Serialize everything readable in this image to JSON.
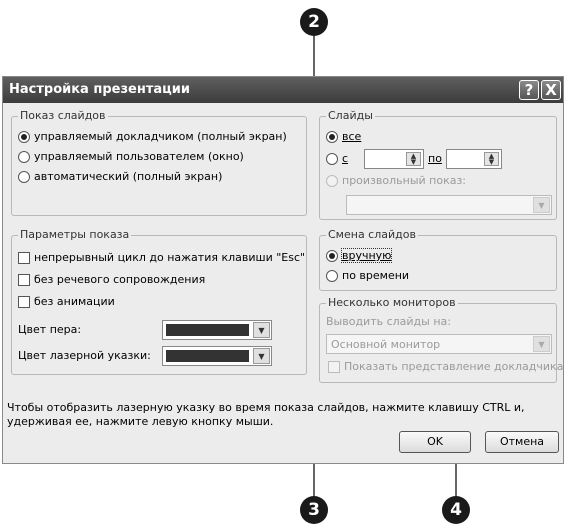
{
  "dialog": {
    "title": "Настройка презентации",
    "help_glyph": "?",
    "close_glyph": "X"
  },
  "show_slides": {
    "title": "Показ слайдов",
    "options": [
      {
        "label": "управляемый докладчиком (полный экран)",
        "selected": true
      },
      {
        "label": "управляемый пользователем (окно)",
        "selected": false
      },
      {
        "label": "автоматический (полный экран)",
        "selected": false
      }
    ]
  },
  "slides": {
    "title": "Слайды",
    "all_label": "все",
    "from_label": "с",
    "to_label": "по",
    "from_value": "",
    "to_value": "",
    "custom_label": "произвольный показ:",
    "custom_value": ""
  },
  "show_options": {
    "title": "Параметры показа",
    "loop_label": "непрерывный цикл до нажатия клавиши \"Esc\"",
    "no_narration_label": "без речевого сопровождения",
    "no_animation_label": "без анимации",
    "pen_color_label": "Цвет пера:",
    "laser_color_label": "Цвет лазерной указки:",
    "pen_color": "#333333",
    "laser_color": "#333333"
  },
  "advance": {
    "title": "Смена слайдов",
    "manual_label": "вручную",
    "timed_label": "по времени"
  },
  "monitors": {
    "title": "Несколько мониторов",
    "display_on_label": "Выводить слайды на:",
    "monitor_value": "Основной монитор",
    "presenter_view_label": "Показать представление докладчика"
  },
  "hint": {
    "line1": "Чтобы отобразить лазерную указку во время показа слайдов, нажмите клавишу CTRL и,",
    "line2": "удерживая ее, нажмите левую кнопку мыши."
  },
  "buttons": {
    "ok": "OK",
    "cancel": "Отмена"
  },
  "callouts": [
    "2",
    "3",
    "4"
  ]
}
